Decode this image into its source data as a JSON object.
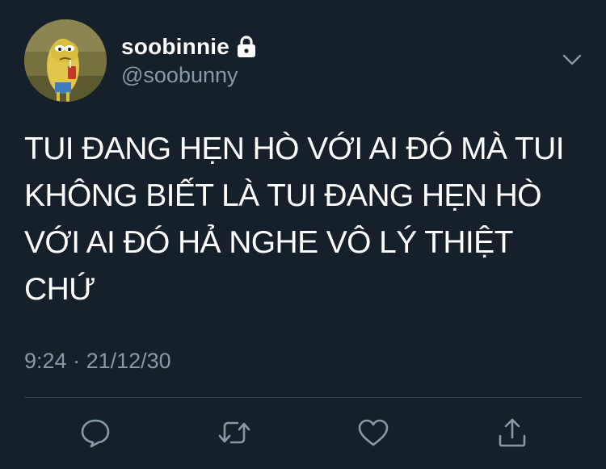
{
  "tweet": {
    "display_name": "soobinnie",
    "handle": "@soobunny",
    "text": "TUI ĐANG HẸN HÒ VỚI AI ĐÓ MÀ TUI KHÔNG BIẾT LÀ TUI ĐANG HẸN HÒ VỚI AI ĐÓ HẢ NGHE VÔ LÝ THIỆT CHỨ",
    "time": "9:24",
    "separator": "·",
    "date": "21/12/30",
    "protected_account_icon": "lock-icon"
  },
  "actions": [
    {
      "name": "reply",
      "icon": "speech-bubble-icon"
    },
    {
      "name": "retweet",
      "icon": "retweet-arrows-icon"
    },
    {
      "name": "like",
      "icon": "heart-icon"
    },
    {
      "name": "share",
      "icon": "share-upload-icon"
    }
  ],
  "more_menu_icon": "chevron-down-icon",
  "colors": {
    "background": "#15202b",
    "primary_text": "#ffffff",
    "secondary_text": "#8899a6",
    "divider": "#38444d"
  }
}
